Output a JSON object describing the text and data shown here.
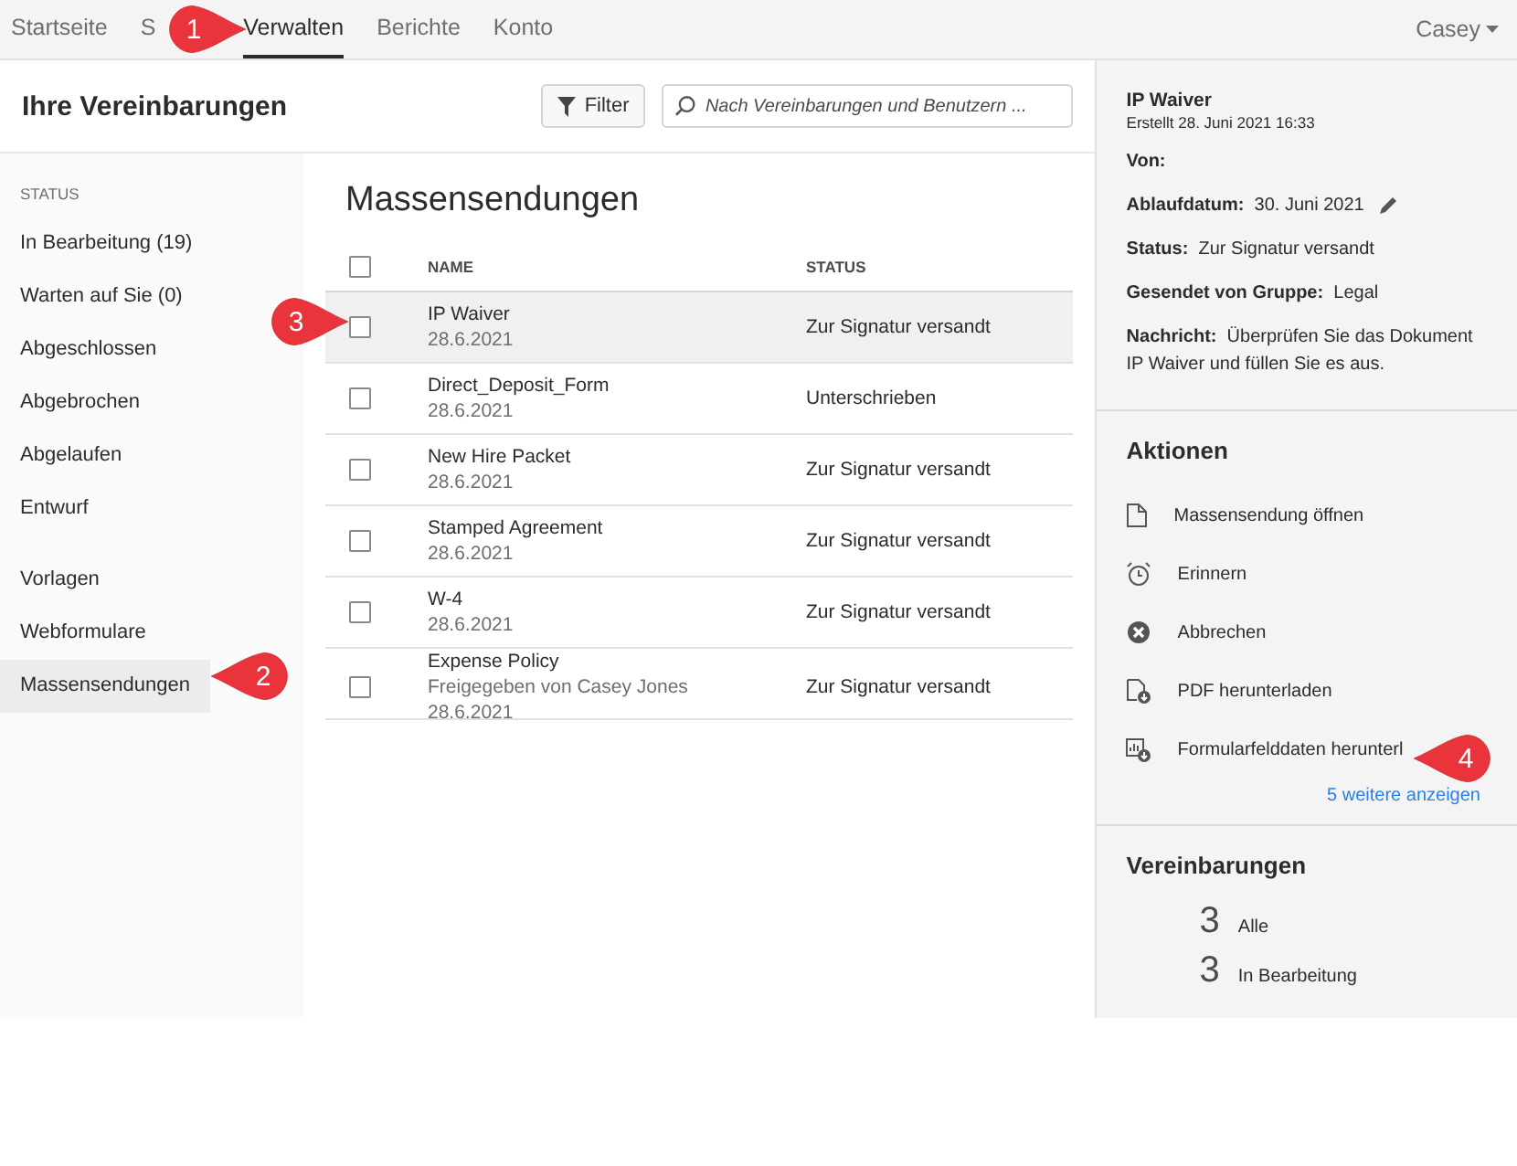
{
  "nav": {
    "tabs": [
      {
        "label": "Startseite",
        "selected": false
      },
      {
        "label": "S",
        "selected": false
      },
      {
        "label": "Verwalten",
        "selected": true
      },
      {
        "label": "Berichte",
        "selected": false
      },
      {
        "label": "Konto",
        "selected": false
      }
    ],
    "user": "Casey"
  },
  "header": {
    "title": "Ihre Vereinbarungen",
    "filter": "Filter",
    "search_placeholder": "Nach Vereinbarungen und Benutzern ..."
  },
  "sidebar": {
    "heading": "STATUS",
    "groups": [
      [
        {
          "label": "In Bearbeitung (19)",
          "selected": false
        },
        {
          "label": "Warten auf Sie (0)",
          "selected": false
        },
        {
          "label": "Abgeschlossen",
          "selected": false
        },
        {
          "label": "Abgebrochen",
          "selected": false
        },
        {
          "label": "Abgelaufen",
          "selected": false
        },
        {
          "label": "Entwurf",
          "selected": false
        }
      ],
      [
        {
          "label": "Vorlagen",
          "selected": false
        },
        {
          "label": "Webformulare",
          "selected": false
        },
        {
          "label": "Massensendungen",
          "selected": true
        }
      ]
    ]
  },
  "table": {
    "title": "Massensendungen",
    "select_all_checked": false,
    "columns": [
      "NAME",
      "STATUS"
    ],
    "rows": [
      {
        "name": "IP Waiver",
        "lines": [
          "28.6.2021"
        ],
        "status": "Zur Signatur versandt",
        "selected": true,
        "checked": false
      },
      {
        "name": "Direct_Deposit_Form",
        "lines": [
          "28.6.2021"
        ],
        "status": "Unterschrieben",
        "selected": false,
        "checked": false
      },
      {
        "name": "New Hire Packet",
        "lines": [
          "28.6.2021"
        ],
        "status": "Zur Signatur versandt",
        "selected": false,
        "checked": false
      },
      {
        "name": "Stamped Agreement",
        "lines": [
          "28.6.2021"
        ],
        "status": "Zur Signatur versandt",
        "selected": false,
        "checked": false
      },
      {
        "name": "W-4",
        "lines": [
          "28.6.2021"
        ],
        "status": "Zur Signatur versandt",
        "selected": false,
        "checked": false
      },
      {
        "name": "Expense Policy",
        "lines": [
          "Freigegeben von Casey Jones",
          "28.6.2021"
        ],
        "status": "Zur Signatur versandt",
        "selected": false,
        "checked": false
      }
    ]
  },
  "details": {
    "title": "IP Waiver",
    "created": "Erstellt 28. Juni 2021 16:33",
    "fields": [
      {
        "label": "Von:"
      },
      {
        "label": "Ablaufdatum:",
        "value": "30. Juni 2021",
        "editable": true
      },
      {
        "label": "Status:",
        "value": "Zur Signatur versandt"
      },
      {
        "label": "Gesendet von Gruppe:",
        "value": "Legal"
      },
      {
        "label": "Nachricht:",
        "value": "Überprüfen Sie das Dokument IP Waiver und füllen Sie es aus."
      }
    ]
  },
  "actions": {
    "title": "Aktionen",
    "items": [
      {
        "kind": "document",
        "label": "Massensendung öffnen"
      },
      {
        "kind": "alarm",
        "label": "Erinnern"
      },
      {
        "kind": "cancel",
        "label": "Abbrechen"
      },
      {
        "kind": "pdf",
        "label": "PDF herunterladen"
      },
      {
        "kind": "formdata",
        "label": "Formularfelddaten herunterl"
      }
    ],
    "more": "5 weitere anzeigen"
  },
  "agreements": {
    "title": "Vereinbarungen",
    "counts": [
      {
        "count": "3",
        "label": "Alle"
      },
      {
        "count": "3",
        "label": "In Bearbeitung"
      }
    ]
  },
  "callouts": [
    {
      "number": "1"
    },
    {
      "number": "2"
    },
    {
      "number": "3"
    },
    {
      "number": "4"
    }
  ]
}
